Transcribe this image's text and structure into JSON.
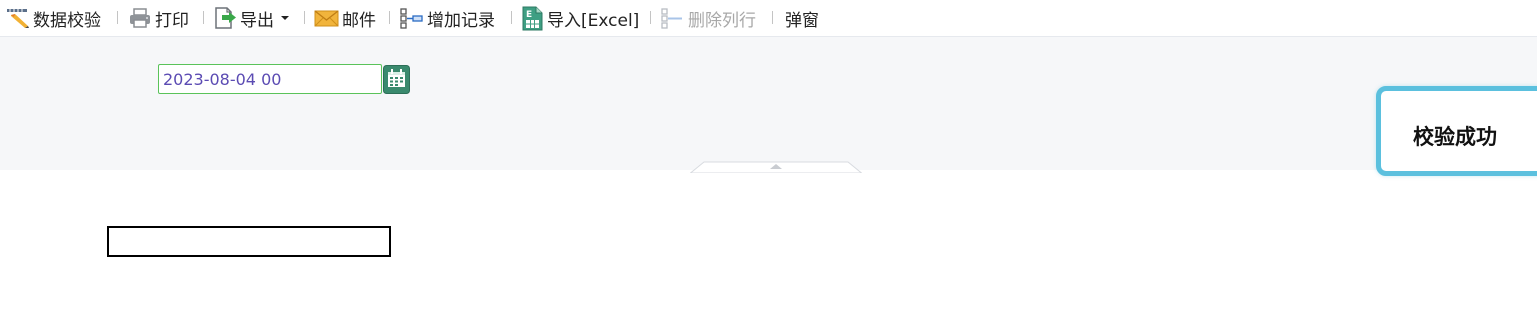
{
  "toolbar": {
    "items": [
      {
        "label": "数据校验",
        "icon": "pencil-ruler-icon"
      },
      {
        "label": "打印",
        "icon": "printer-icon"
      },
      {
        "label": "导出",
        "icon": "export-icon"
      },
      {
        "label": "邮件",
        "icon": "mail-icon"
      },
      {
        "label": "增加记录",
        "icon": "add-record-icon"
      },
      {
        "label": "导入[Excel]",
        "icon": "excel-icon"
      },
      {
        "label": "删除列行",
        "icon": "delete-row-icon",
        "disabled": true
      },
      {
        "label": "弹窗"
      }
    ]
  },
  "form": {
    "date_value": "2023-08-04 00"
  },
  "toast": {
    "message": "校验成功",
    "border_color": "#5bc0de"
  },
  "colors": {
    "date_text": "#5b4bb3",
    "date_border": "#5ac35a",
    "calendar_button": "#3a8a6e",
    "panel_background": "#f6f7f9"
  }
}
